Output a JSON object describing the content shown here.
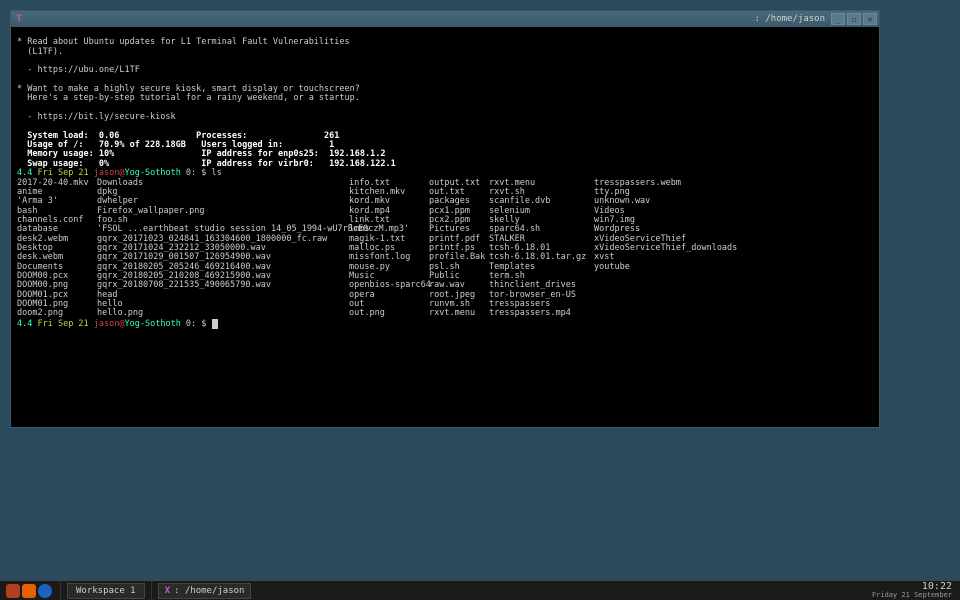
{
  "window": {
    "title": ": /home/jason",
    "min_icon": "_",
    "max_icon": "☐",
    "close_icon": "✕"
  },
  "motd": {
    "line1": "* Read about Ubuntu updates for L1 Terminal Fault Vulnerabilities",
    "line2": "  (L1TF).",
    "link1": "  - https://ubu.one/L1TF",
    "line3": "* Want to make a highly secure kiosk, smart display or touchscreen?",
    "line4": "  Here's a step-by-step tutorial for a rainy weekend, or a startup.",
    "link2": "  - https://bit.ly/secure-kiosk"
  },
  "stats": {
    "l1": "  System load:  0.06               Processes:               261",
    "l2": "  Usage of /:   70.9% of 228.18GB   Users logged in:         1",
    "l3": "  Memory usage: 10%                 IP address for enp0s25:  192.168.1.2",
    "l4": "  Swap usage:   0%                  IP address for virbr0:   192.168.122.1"
  },
  "prompt1": {
    "time": "4.4",
    "date": "Fri Sep 21",
    "user": "jason",
    "at": "@",
    "host": "Yog-Sothoth",
    "idx": " 0: $ ",
    "cmd": "ls"
  },
  "prompt2": {
    "time": "4.4",
    "date": "Fri Sep 21",
    "user": "jason",
    "at": "@",
    "host": "Yog-Sothoth",
    "idx": " 0: $ "
  },
  "ls": {
    "c1": "2017-20-40.mkv\nanime\n'Arma 3'\nbash\nchannels.conf\ndatabase\ndesk2.webm\nDesktop\ndesk.webm\nDocuments\nDOOM00.pcx\nDOOM00.png\nDOOM01.pcx\nDOOM01.png\ndoom2.png",
    "c2": "Downloads\ndpkg\ndwhelper\nFirefox_wallpaper.png\nfoo.sh\n'FSOL ...earthbeat studio session 14_05_1994-wU7rBcE0czM.mp3'\ngqrx_20171023_024841_163304600_1800000_fc.raw\ngqrx_20171024_232212_33050000.wav\ngqrx_20171029_001507_126954900.wav\ngqrx_20180205_205246_469216400.wav\ngqrx_20180205_210208_469215900.wav\ngqrx_20180708_221535_490065790.wav\nhead\nhello\nhello.png",
    "c3": "info.txt\nkitchen.mkv\nkord.mkv\nkord.mp4\nlink.txt\nlmms\nmagik-1.txt\nmalloc.ps\nmissfont.log\nmouse.py\nMusic\nopenbios-sparc64\nopera\nout\nout.png",
    "c4": "output.txt\nout.txt\npackages\npcx1.ppm\npcx2.ppm\nPictures\nprintf.pdf\nprintf.ps\nprofile.Bak\npsl.sh\nPublic\nraw.wav\nroot.jpeg\nrunvm.sh\nrxvt.menu",
    "c5": "rxvt.menu\nrxvt.sh\nscanfile.dvb\nselenium\nskelly\nsparc64.sh\nSTALKER\ntcsh-6.18.01\ntcsh-6.18.01.tar.gz\nTemplates\nterm.sh\nthinclient_drives\ntor-browser_en-US\ntresspassers\ntresspassers.mp4",
    "c6": "tresspassers.webm\ntty.png\nunknown.wav\nVideos\nwin7.img\nWordpress\nxVideoServiceThief\nxVideoServiceThief_downloads\nxvst\nyoutube"
  },
  "taskbar": {
    "workspace": "Workspace 1",
    "task_label": ": /home/jason",
    "time": "10:22",
    "date": "Friday 21 September"
  }
}
